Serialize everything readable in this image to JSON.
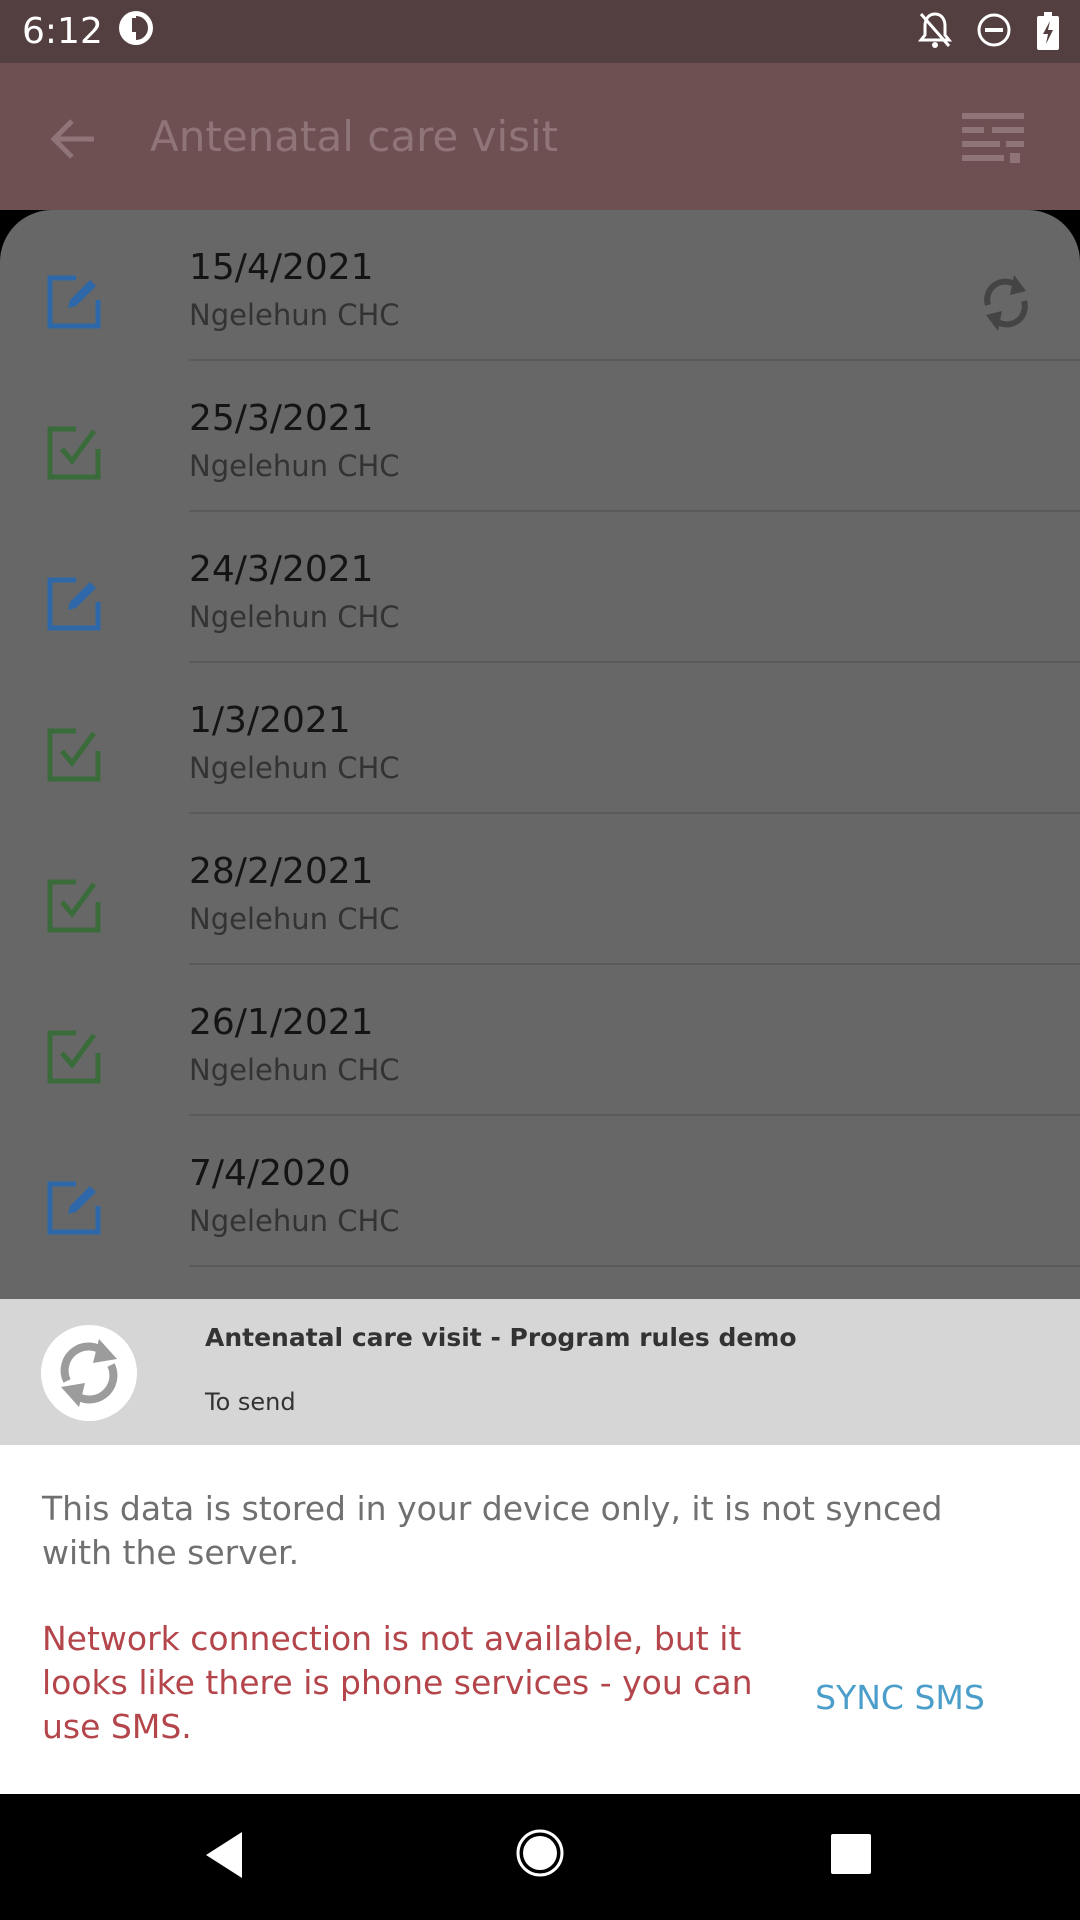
{
  "status_bar": {
    "time": "6:12",
    "icons": [
      "app-notification-icon",
      "notifications-off-icon",
      "do-not-disturb-icon",
      "battery-charging-icon"
    ]
  },
  "app_bar": {
    "title": "Antenatal care visit",
    "back_icon": "back-arrow-icon",
    "filter_icon": "filter-list-icon"
  },
  "events": [
    {
      "date": "15/4/2021",
      "org_unit": "Ngelehun CHC",
      "status": "open",
      "sync_pending": true
    },
    {
      "date": "25/3/2021",
      "org_unit": "Ngelehun CHC",
      "status": "completed",
      "sync_pending": false
    },
    {
      "date": "24/3/2021",
      "org_unit": "Ngelehun CHC",
      "status": "open",
      "sync_pending": false
    },
    {
      "date": "1/3/2021",
      "org_unit": "Ngelehun CHC",
      "status": "completed",
      "sync_pending": false
    },
    {
      "date": "28/2/2021",
      "org_unit": "Ngelehun CHC",
      "status": "completed",
      "sync_pending": false
    },
    {
      "date": "26/1/2021",
      "org_unit": "Ngelehun CHC",
      "status": "completed",
      "sync_pending": false
    },
    {
      "date": "7/4/2020",
      "org_unit": "Ngelehun CHC",
      "status": "open",
      "sync_pending": false
    }
  ],
  "sync_sheet": {
    "title": "Antenatal care visit - Program rules demo",
    "state": "To send",
    "info": "This data is stored in your device only, it is not synced with the server.",
    "warning": "Network connection is not available, but it looks like there is phone services - you can use SMS.",
    "sms_button": "SYNC SMS"
  },
  "colors": {
    "open_icon": "#2e68a8",
    "completed_icon": "#3a6b3a",
    "warning_text": "#b3454b",
    "sms_button": "#4a9ec9",
    "status_bar": "#533e40",
    "app_bar": "#6f5052"
  }
}
